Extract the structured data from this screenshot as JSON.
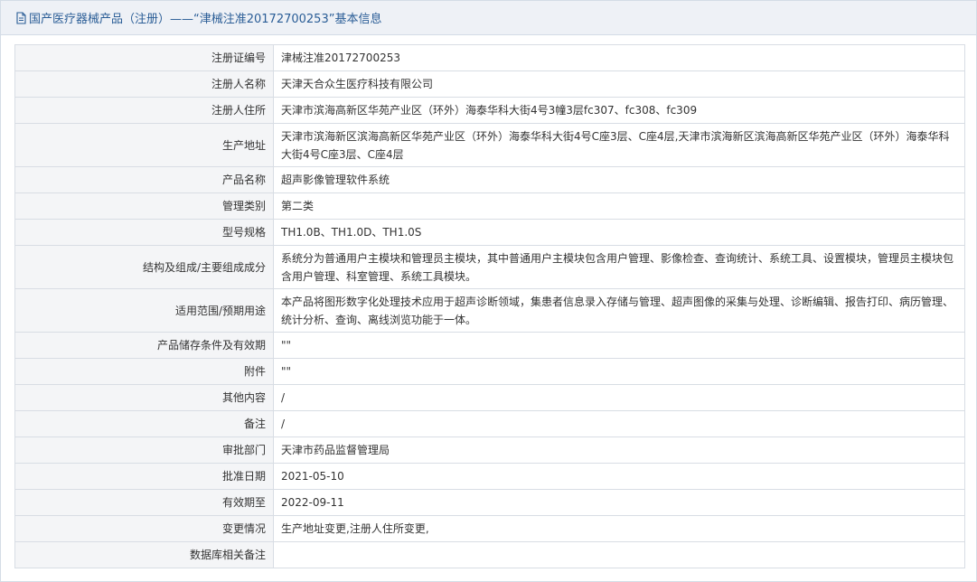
{
  "header": {
    "title": "国产医疗器械产品（注册）——“津械注准20172700253”基本信息"
  },
  "rows": [
    {
      "label": "注册证编号",
      "value": "津械注准20172700253"
    },
    {
      "label": "注册人名称",
      "value": "天津天合众生医疗科技有限公司"
    },
    {
      "label": "注册人住所",
      "value": "天津市滨海高新区华苑产业区（环外）海泰华科大街4号3幢3层fc307、fc308、fc309"
    },
    {
      "label": "生产地址",
      "value": "天津市滨海新区滨海高新区华苑产业区（环外）海泰华科大街4号C座3层、C座4层,天津市滨海新区滨海高新区华苑产业区（环外）海泰华科大街4号C座3层、C座4层"
    },
    {
      "label": "产品名称",
      "value": "超声影像管理软件系统"
    },
    {
      "label": "管理类别",
      "value": "第二类"
    },
    {
      "label": "型号规格",
      "value": "TH1.0B、TH1.0D、TH1.0S"
    },
    {
      "label": "结构及组成/主要组成成分",
      "value": "系统分为普通用户主模块和管理员主模块，其中普通用户主模块包含用户管理、影像检查、查询统计、系统工具、设置模块，管理员主模块包含用户管理、科室管理、系统工具模块。"
    },
    {
      "label": "适用范围/预期用途",
      "value": "本产品将图形数字化处理技术应用于超声诊断领域，集患者信息录入存储与管理、超声图像的采集与处理、诊断编辑、报告打印、病历管理、统计分析、查询、离线浏览功能于一体。"
    },
    {
      "label": "产品储存条件及有效期",
      "value": "\"\""
    },
    {
      "label": "附件",
      "value": "\"\""
    },
    {
      "label": "其他内容",
      "value": "/"
    },
    {
      "label": "备注",
      "value": "/"
    },
    {
      "label": "审批部门",
      "value": "天津市药品监督管理局"
    },
    {
      "label": "批准日期",
      "value": "2021-05-10"
    },
    {
      "label": "有效期至",
      "value": "2022-09-11"
    },
    {
      "label": "变更情况",
      "value": "生产地址变更,注册人住所变更,"
    },
    {
      "label": "数据库相关备注",
      "value": ""
    }
  ],
  "icons": {
    "title_icon": "document-icon"
  },
  "colors": {
    "title_text": "#2a5d96",
    "title_bg": "#eef1f6",
    "label_bg": "#f4f5f7",
    "border": "#d8dde4"
  }
}
